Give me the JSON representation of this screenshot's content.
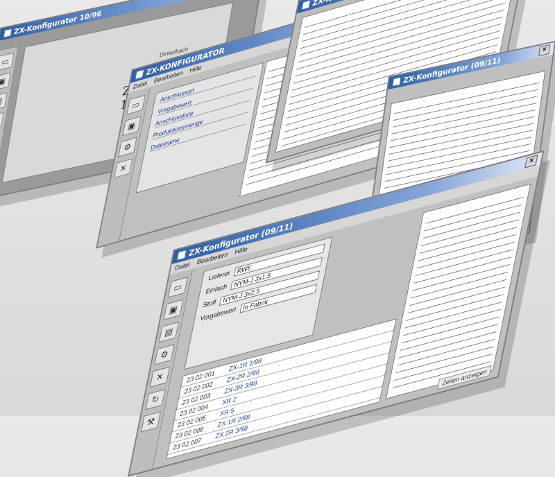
{
  "app": {
    "title_main": "ZX-Konfigurator 10/96",
    "title_front": "ZX-Konfigurator (09/11)",
    "title_mid": "ZX-KONFIGURATOR",
    "subtitle": "Dinkelbach"
  },
  "menus": [
    "Datei",
    "Bearbeiten",
    "Hilfe"
  ],
  "form": {
    "fields": [
      {
        "label": "Lieferer",
        "value": "RWE"
      },
      {
        "label": "Einfach",
        "value": "NYM-J 3x1,5"
      },
      {
        "label": "Stoff",
        "value": "NYM-J 3x2,5"
      },
      {
        "label": "Vorgabewert",
        "value": "In Fabrik"
      }
    ]
  },
  "table_rows": [
    {
      "num": "23 02 001",
      "text": "ZX-1R 1/98"
    },
    {
      "num": "23 02 002",
      "text": "ZX-2R 2/98"
    },
    {
      "num": "23 02 003",
      "text": "ZX-3R 3/98"
    },
    {
      "num": "23 02 004",
      "text": "XR 2"
    },
    {
      "num": "23 02 005",
      "text": "XR 5"
    },
    {
      "num": "23 02 006",
      "text": "ZX 1R 2/98"
    },
    {
      "num": "23 02 007",
      "text": "ZX 2R 3/98"
    }
  ],
  "middle_list": [
    "Anschlussart",
    "Vorgabewert",
    "Anschlussliste",
    "Produktionsmenge",
    "Dateiname"
  ],
  "status": {
    "label": "Zeilen anzeigen"
  },
  "toolbar_icons": [
    "document-icon",
    "folder-icon",
    "save-icon",
    "settings-icon",
    "close-icon",
    "arrow-icon",
    "tools-icon"
  ]
}
